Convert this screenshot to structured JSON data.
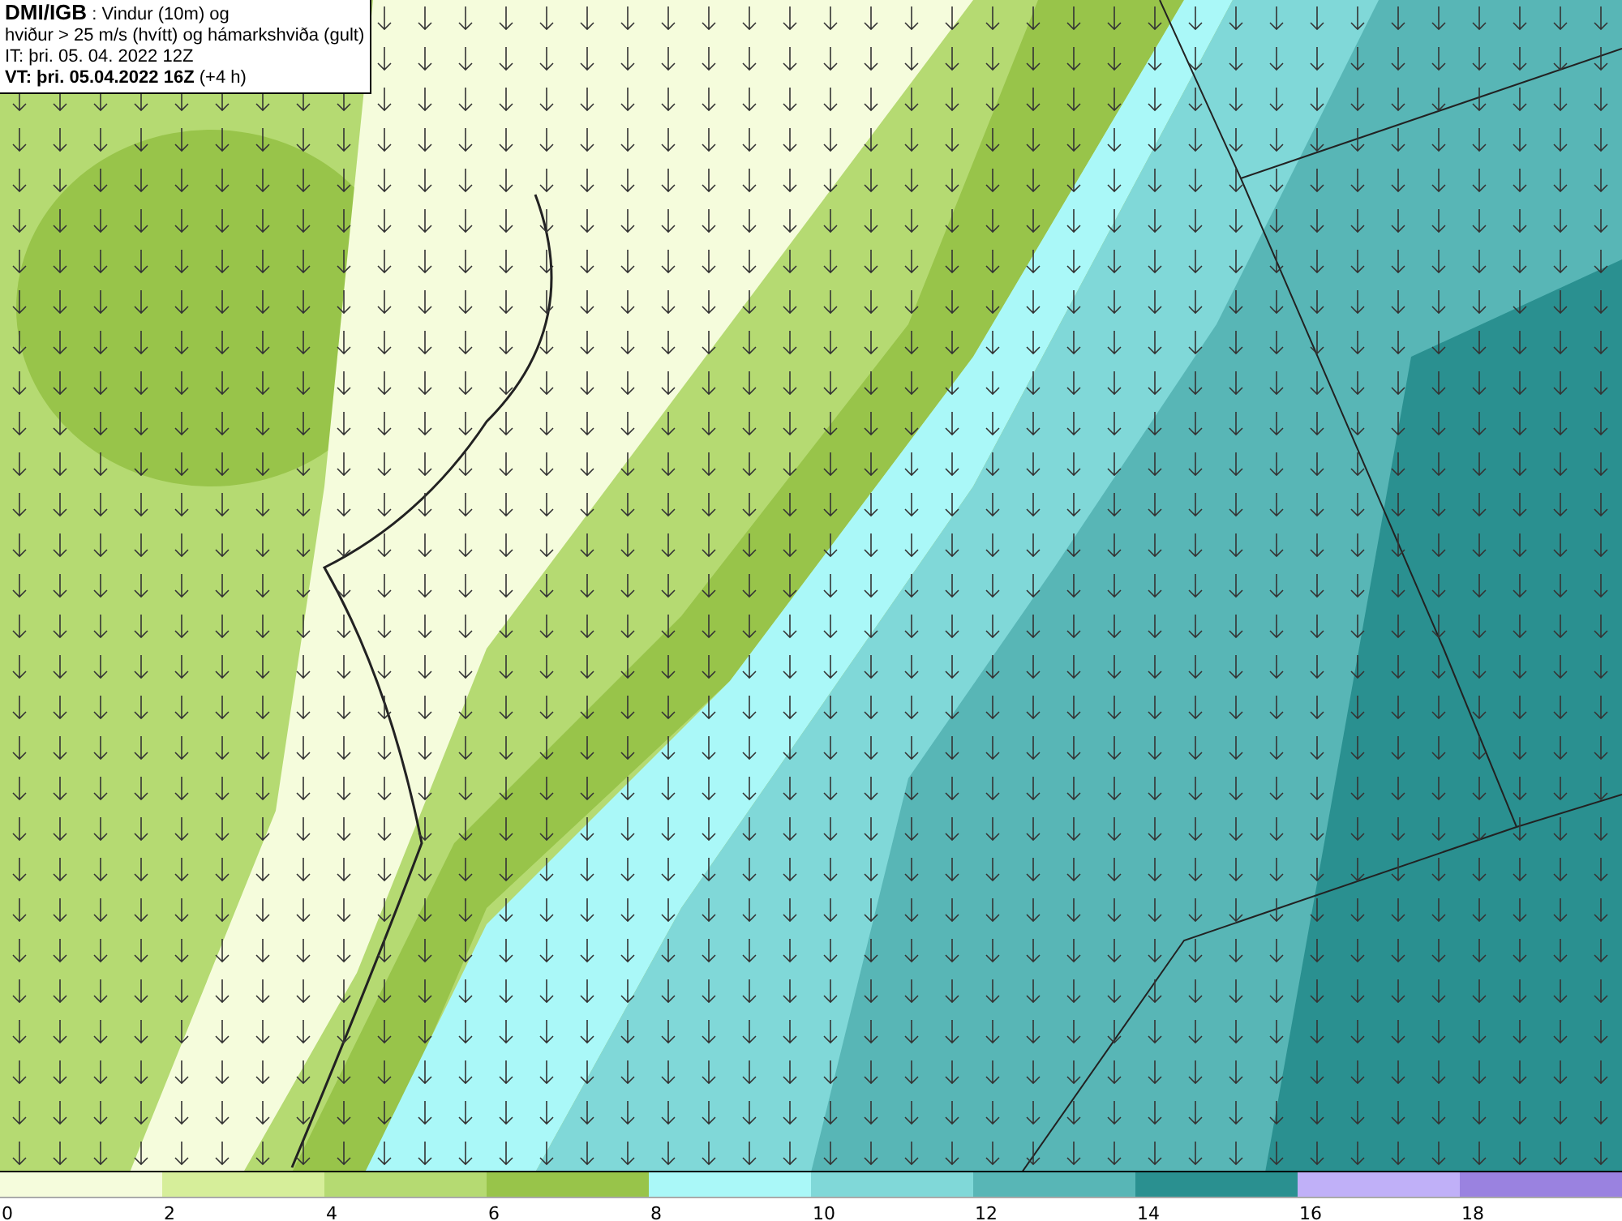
{
  "map": {
    "kind": "map-picture"
  },
  "title_box": {
    "lines": [
      "**DMI/IGB** : Vindur (10m) og",
      "hviður > 25 m/s (hvítt) og hámarkshviða (gult)",
      "IT: þri. 05. 04. 2022 12Z",
      "**VT: þri. 05.04.2022 16Z** (+4 h)"
    ]
  },
  "legend": {
    "bins": [
      {
        "color": "#f5fcdc"
      },
      {
        "color": "#d6ee9a"
      },
      {
        "color": "#b5da72"
      },
      {
        "color": "#98c44a"
      },
      {
        "color": "#aaf8f8"
      },
      {
        "color": "#80d8d8"
      },
      {
        "color": "#58b6b6"
      },
      {
        "color": "#2a9090"
      },
      {
        "color": "#c0b0f8"
      },
      {
        "color": "#9a82e0"
      }
    ],
    "ticks": [
      "0",
      "2",
      "4",
      "6",
      "8",
      "10",
      "12",
      "14",
      "16",
      "18"
    ]
  }
}
